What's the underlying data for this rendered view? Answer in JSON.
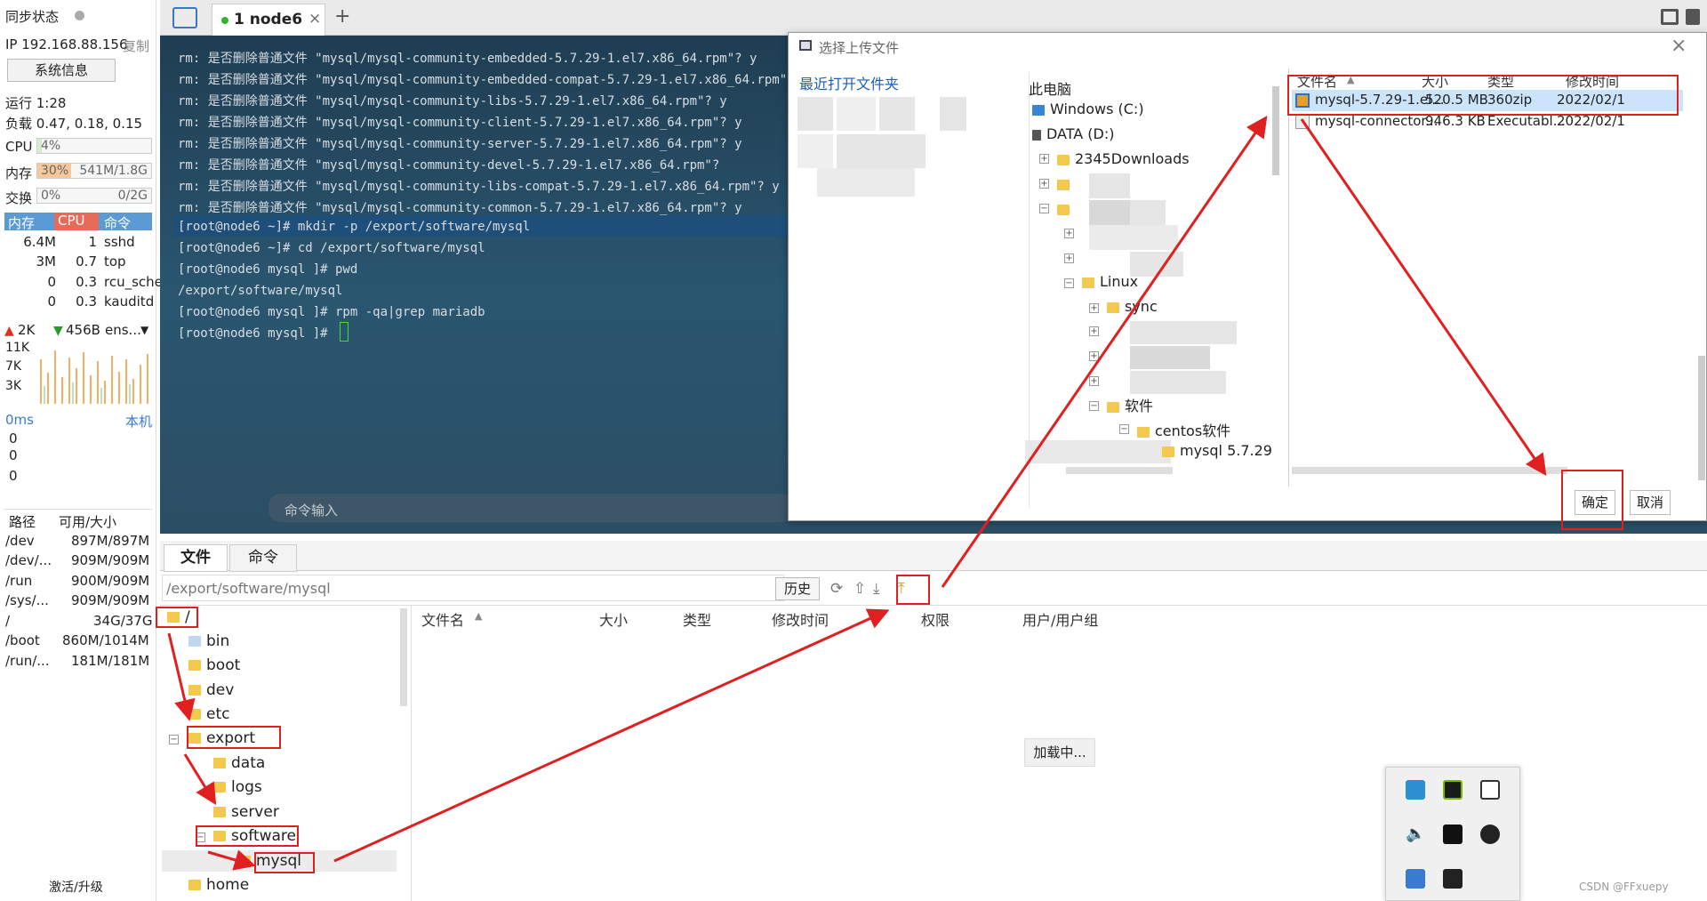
{
  "sidebar": {
    "sync_status": "同步状态",
    "ip": "IP 192.168.88.156",
    "copy": "复制",
    "sysinfo_button": "系统信息",
    "uptime": "运行 1:28",
    "load": "负载 0.47, 0.18, 0.15",
    "cpu_label": "CPU",
    "cpu_value": "4%",
    "cpu_percent": 4,
    "mem_label": "内存",
    "mem_percent_text": "30%",
    "mem_value": "541M/1.8G",
    "mem_percent": 30,
    "swap_label": "交换",
    "swap_percent_text": "0%",
    "swap_value": "0/2G",
    "proc_headers": [
      "内存",
      "CPU",
      "命令"
    ],
    "processes": [
      {
        "mem": "6.4M",
        "cpu": "1",
        "cmd": "sshd"
      },
      {
        "mem": "3M",
        "cpu": "0.7",
        "cmd": "top"
      },
      {
        "mem": "0",
        "cpu": "0.3",
        "cmd": "rcu_sche"
      },
      {
        "mem": "0",
        "cpu": "0.3",
        "cmd": "kauditd"
      }
    ],
    "net_up": "2K",
    "net_down": "456B",
    "net_iface": "ens...",
    "net_scale": [
      "11K",
      "7K",
      "3K"
    ],
    "latency": "0ms",
    "latency_target": "本机",
    "latency_values": [
      "0",
      "0",
      "0"
    ],
    "disk_headers": [
      "路径",
      "可用/大小"
    ],
    "disks": [
      {
        "path": "/dev",
        "size": "897M/897M"
      },
      {
        "path": "/dev/...",
        "size": "909M/909M"
      },
      {
        "path": "/run",
        "size": "900M/909M"
      },
      {
        "path": "/sys/...",
        "size": "909M/909M"
      },
      {
        "path": "/",
        "size": "34G/37G"
      },
      {
        "path": "/boot",
        "size": "860M/1014M"
      },
      {
        "path": "/run/...",
        "size": "181M/181M"
      }
    ],
    "activate": "激活/升级"
  },
  "tabs": {
    "active_label": "1 node6",
    "close": "×",
    "add": "+"
  },
  "terminal": {
    "lines": [
      "rm: 是否删除普通文件 \"mysql/mysql-community-embedded-5.7.29-1.el7.x86_64.rpm\"? y",
      "rm: 是否删除普通文件 \"mysql/mysql-community-embedded-compat-5.7.29-1.el7.x86_64.rpm\"? y",
      "rm: 是否删除普通文件 \"mysql/mysql-community-libs-5.7.29-1.el7.x86_64.rpm\"? y",
      "rm: 是否删除普通文件 \"mysql/mysql-community-client-5.7.29-1.el7.x86_64.rpm\"? y",
      "rm: 是否删除普通文件 \"mysql/mysql-community-server-5.7.29-1.el7.x86_64.rpm\"? y",
      "rm: 是否删除普通文件 \"mysql/mysql-community-devel-5.7.29-1.el7.x86_64.rpm\"?",
      "rm: 是否删除普通文件 \"mysql/mysql-community-libs-compat-5.7.29-1.el7.x86_64.rpm\"? y",
      "rm: 是否删除普通文件 \"mysql/mysql-community-common-5.7.29-1.el7.x86_64.rpm\"? y",
      "[root@node6 ~]# mkdir -p /export/software/mysql",
      "[root@node6 ~]# cd /export/software/mysql",
      "[root@node6 mysql ]# pwd",
      "/export/software/mysql",
      "[root@node6 mysql ]# rpm -qa|grep mariadb",
      "[root@node6 mysql ]# "
    ],
    "command_input": "命令输入"
  },
  "dialog": {
    "title": "选择上传文件",
    "recent": "最近打开文件夹",
    "tree": {
      "this_pc": "此电脑",
      "windows": "Windows (C:)",
      "data": "DATA (D:)",
      "downloads": "2345Downloads",
      "linux": "Linux",
      "sync": "sync",
      "soft": "软件",
      "centos_soft": "centos软件",
      "mysql_folder": "mysql 5.7.29"
    },
    "columns": [
      "文件名",
      "大小",
      "类型",
      "修改时间"
    ],
    "files": [
      {
        "name": "mysql-5.7.29-1.el...",
        "size": "520.5 MB",
        "type": "360zip",
        "date": "2022/02/1"
      },
      {
        "name": "mysql-connector...",
        "size": "946.3 KB",
        "type": "Executabl...",
        "date": "2022/02/1"
      }
    ],
    "ok": "确定",
    "cancel": "取消"
  },
  "filepanel": {
    "tab_files": "文件",
    "tab_commands": "命令",
    "path": "/export/software/mysql",
    "history": "历史",
    "tree": [
      "/",
      "bin",
      "boot",
      "dev",
      "etc",
      "export",
      "data",
      "logs",
      "server",
      "software",
      "mysql",
      "home"
    ],
    "columns": [
      "文件名",
      "大小",
      "类型",
      "修改时间",
      "权限",
      "用户/用户组"
    ],
    "loading": "加载中..."
  },
  "watermark": "CSDN @FFxuepy"
}
